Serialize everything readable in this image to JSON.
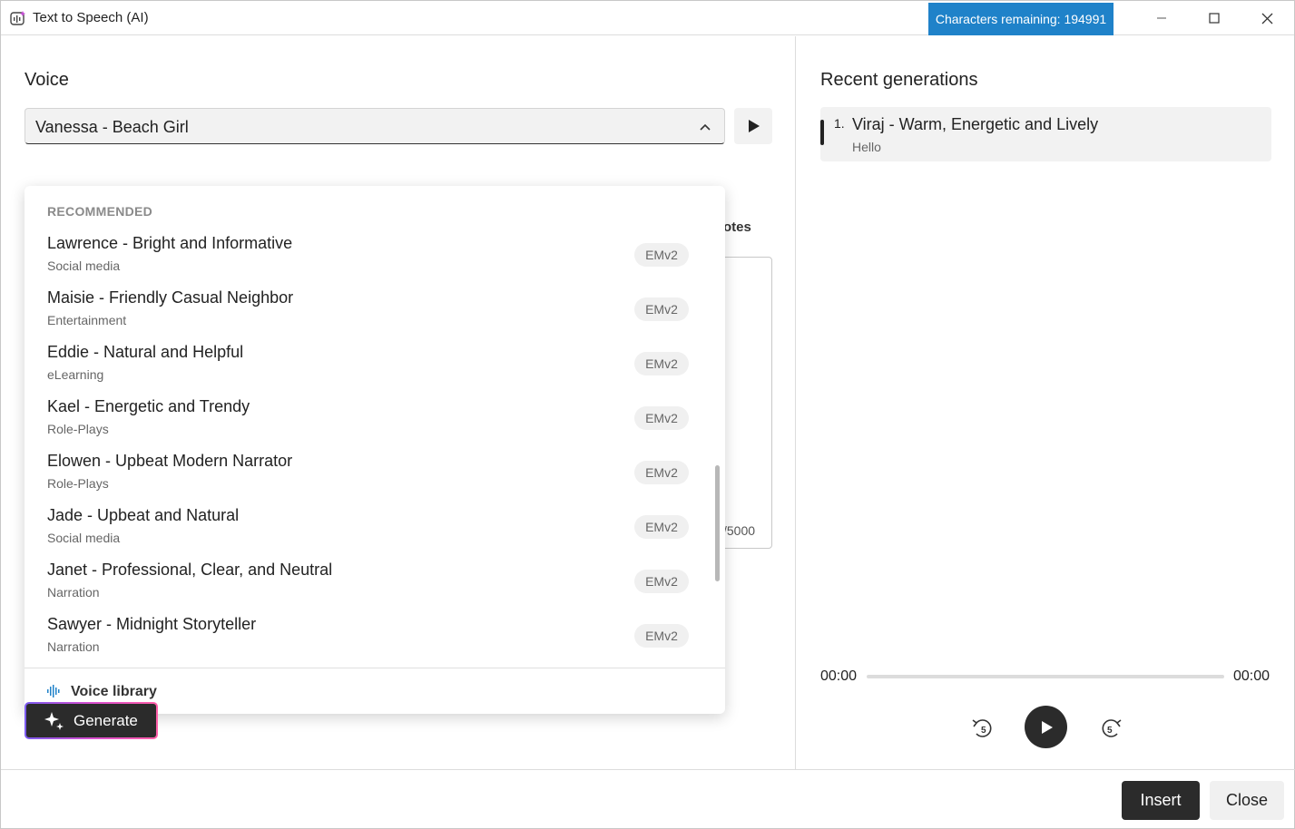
{
  "window": {
    "title": "Text to Speech (AI)",
    "characters_remaining": "Characters remaining: 194991"
  },
  "voice": {
    "heading": "Voice",
    "selected": "Vanessa - Beach Girl"
  },
  "background": {
    "notes_fragment": "otes",
    "count_fragment": "/5000"
  },
  "dropdown": {
    "section": "RECOMMENDED",
    "items": [
      {
        "name": "Lawrence - Bright and Informative",
        "category": "Social media",
        "tag": "EMv2"
      },
      {
        "name": "Maisie - Friendly Casual Neighbor",
        "category": "Entertainment",
        "tag": "EMv2"
      },
      {
        "name": "Eddie - Natural and Helpful",
        "category": "eLearning",
        "tag": "EMv2"
      },
      {
        "name": "Kael - Energetic and Trendy",
        "category": "Role-Plays",
        "tag": "EMv2"
      },
      {
        "name": "Elowen - Upbeat Modern Narrator",
        "category": "Role-Plays",
        "tag": "EMv2"
      },
      {
        "name": "Jade - Upbeat and Natural",
        "category": "Social media",
        "tag": "EMv2"
      },
      {
        "name": "Janet - Professional, Clear, and Neutral",
        "category": "Narration",
        "tag": "EMv2"
      },
      {
        "name": "Sawyer - Midnight Storyteller",
        "category": "Narration",
        "tag": "EMv2"
      }
    ],
    "footer_label": "Voice library"
  },
  "generate": {
    "label": "Generate"
  },
  "recent": {
    "heading": "Recent generations",
    "items": [
      {
        "number": "1.",
        "voice": "Viraj - Warm, Energetic and Lively",
        "text": "Hello"
      }
    ]
  },
  "player": {
    "current_time": "00:00",
    "total_time": "00:00",
    "progress": 0
  },
  "footer": {
    "insert_label": "Insert",
    "close_label": "Close"
  },
  "colors": {
    "badge": "#1f82c9",
    "dark_button": "#2b2b2b",
    "generate_gradient_start": "#7b5cf0",
    "generate_gradient_end": "#ff5fa8"
  },
  "icons": [
    "app-icon",
    "minimize-icon",
    "maximize-icon",
    "close-icon",
    "chevron-up-icon",
    "play-icon",
    "waveform-icon",
    "sparkle-icon",
    "rewind-5-icon",
    "forward-5-icon"
  ]
}
